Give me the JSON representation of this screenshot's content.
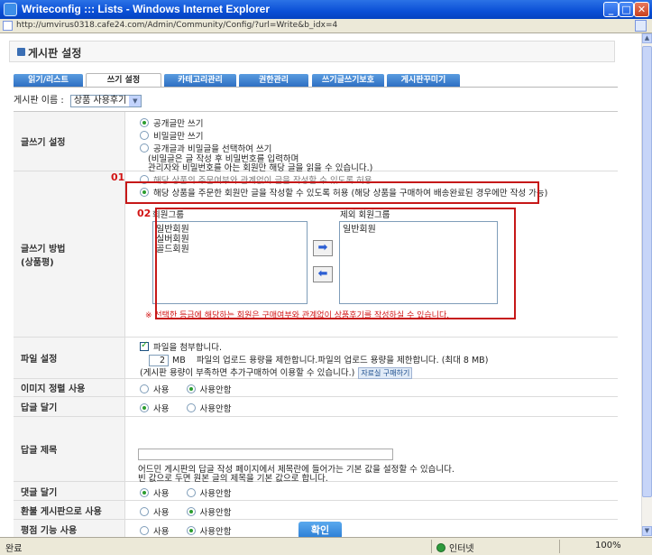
{
  "window": {
    "title": "Writeconfig ::: Lists - Windows Internet Explorer",
    "url": "http://umvirus0318.cafe24.com/Admin/Community/Config/?url=Write&b_idx=4",
    "status": "완료",
    "zone": "인터넷",
    "zoom": "100%"
  },
  "page": {
    "title": "게시판 설정"
  },
  "tabs": [
    {
      "label": "읽기/리스트"
    },
    {
      "label": "쓰기 설정"
    },
    {
      "label": "카테고리관리"
    },
    {
      "label": "권한관리"
    },
    {
      "label": "쓰기글쓰기보호"
    },
    {
      "label": "게시판꾸미기"
    }
  ],
  "board_select": {
    "label": "게시판 이름 :",
    "value": "상품 사용후기"
  },
  "writing_settings": {
    "label": "글쓰기 설정",
    "options": [
      "공개글만 쓰기",
      "비밀글만 쓰기",
      "공개글과 비밀글을 선택하여 쓰기"
    ],
    "note1": "(비밀글은 글 작성 후 비밀번호를 입력하며",
    "note2": "관리자와 비밀번호를 아는 회원만 해당 글을 읽을 수 있습니다.)"
  },
  "writing_method": {
    "label1": "글쓰기 방법",
    "label2": "(상품평)",
    "option_hidden": "해당 상품의 주문여부와 관계없이 글을 작성할 수 있도록 허용",
    "option_selected": "해당 상품을 주문한 회원만 글을 작성할 수 있도록 허용 (해당 상품을 구매하여 배송완료된 경우에만 작성 가능)",
    "member_groups_label": "회원그룹",
    "member_groups": [
      "일반회원",
      "실버회원",
      "골드회원"
    ],
    "excluded_groups_label": "제외 회원그룹",
    "excluded_groups": [
      "일반회원"
    ],
    "warning": "※ 선택한 등급에 해당하는 회원은 구매여부와 관계없이 상품후기를 작성하실 수 있습니다."
  },
  "annotations": {
    "first": "01",
    "second": "02"
  },
  "file_settings": {
    "label": "파일 설정",
    "attach_label": "파일을 첨부합니다.",
    "count": "2",
    "unit": "MB",
    "limit_text": "파일의 업로드 용량을 제한합니다.파일의 업로드 용량을 제한합니다. (최대 8 MB)",
    "note": "(게시판 용량이 부족하면 추가구매하여 이용할 수 있습니다.)",
    "buy_button": "자료실 구매하기"
  },
  "image_sort": {
    "label": "이미지 정렬 사용",
    "on": "사용",
    "off": "사용안함"
  },
  "reply": {
    "label": "답글 달기",
    "on": "사용",
    "off": "사용안함"
  },
  "reply_title": {
    "label": "답글 제목",
    "value": "",
    "help1": "어드민 게시판의 답글 작성 페이지에서 제목란에 들어가는 기본 값을 설정할 수 있습니다.",
    "help2": "빈 값으로 두면 원본 글의 제목을 기본 값으로 합니다."
  },
  "comment": {
    "label": "댓글 달기",
    "on": "사용",
    "off": "사용안함"
  },
  "refund_board": {
    "label": "환불 게시판으로 사용",
    "on": "사용",
    "off": "사용안함"
  },
  "rating": {
    "label": "평점 기능 사용",
    "on": "사용",
    "off": "사용안함"
  },
  "confirm": "확인",
  "colors": {
    "accent_red": "#c61818",
    "tab_blue": "#2e6fc2",
    "radio_green": "#2b9d2f"
  }
}
